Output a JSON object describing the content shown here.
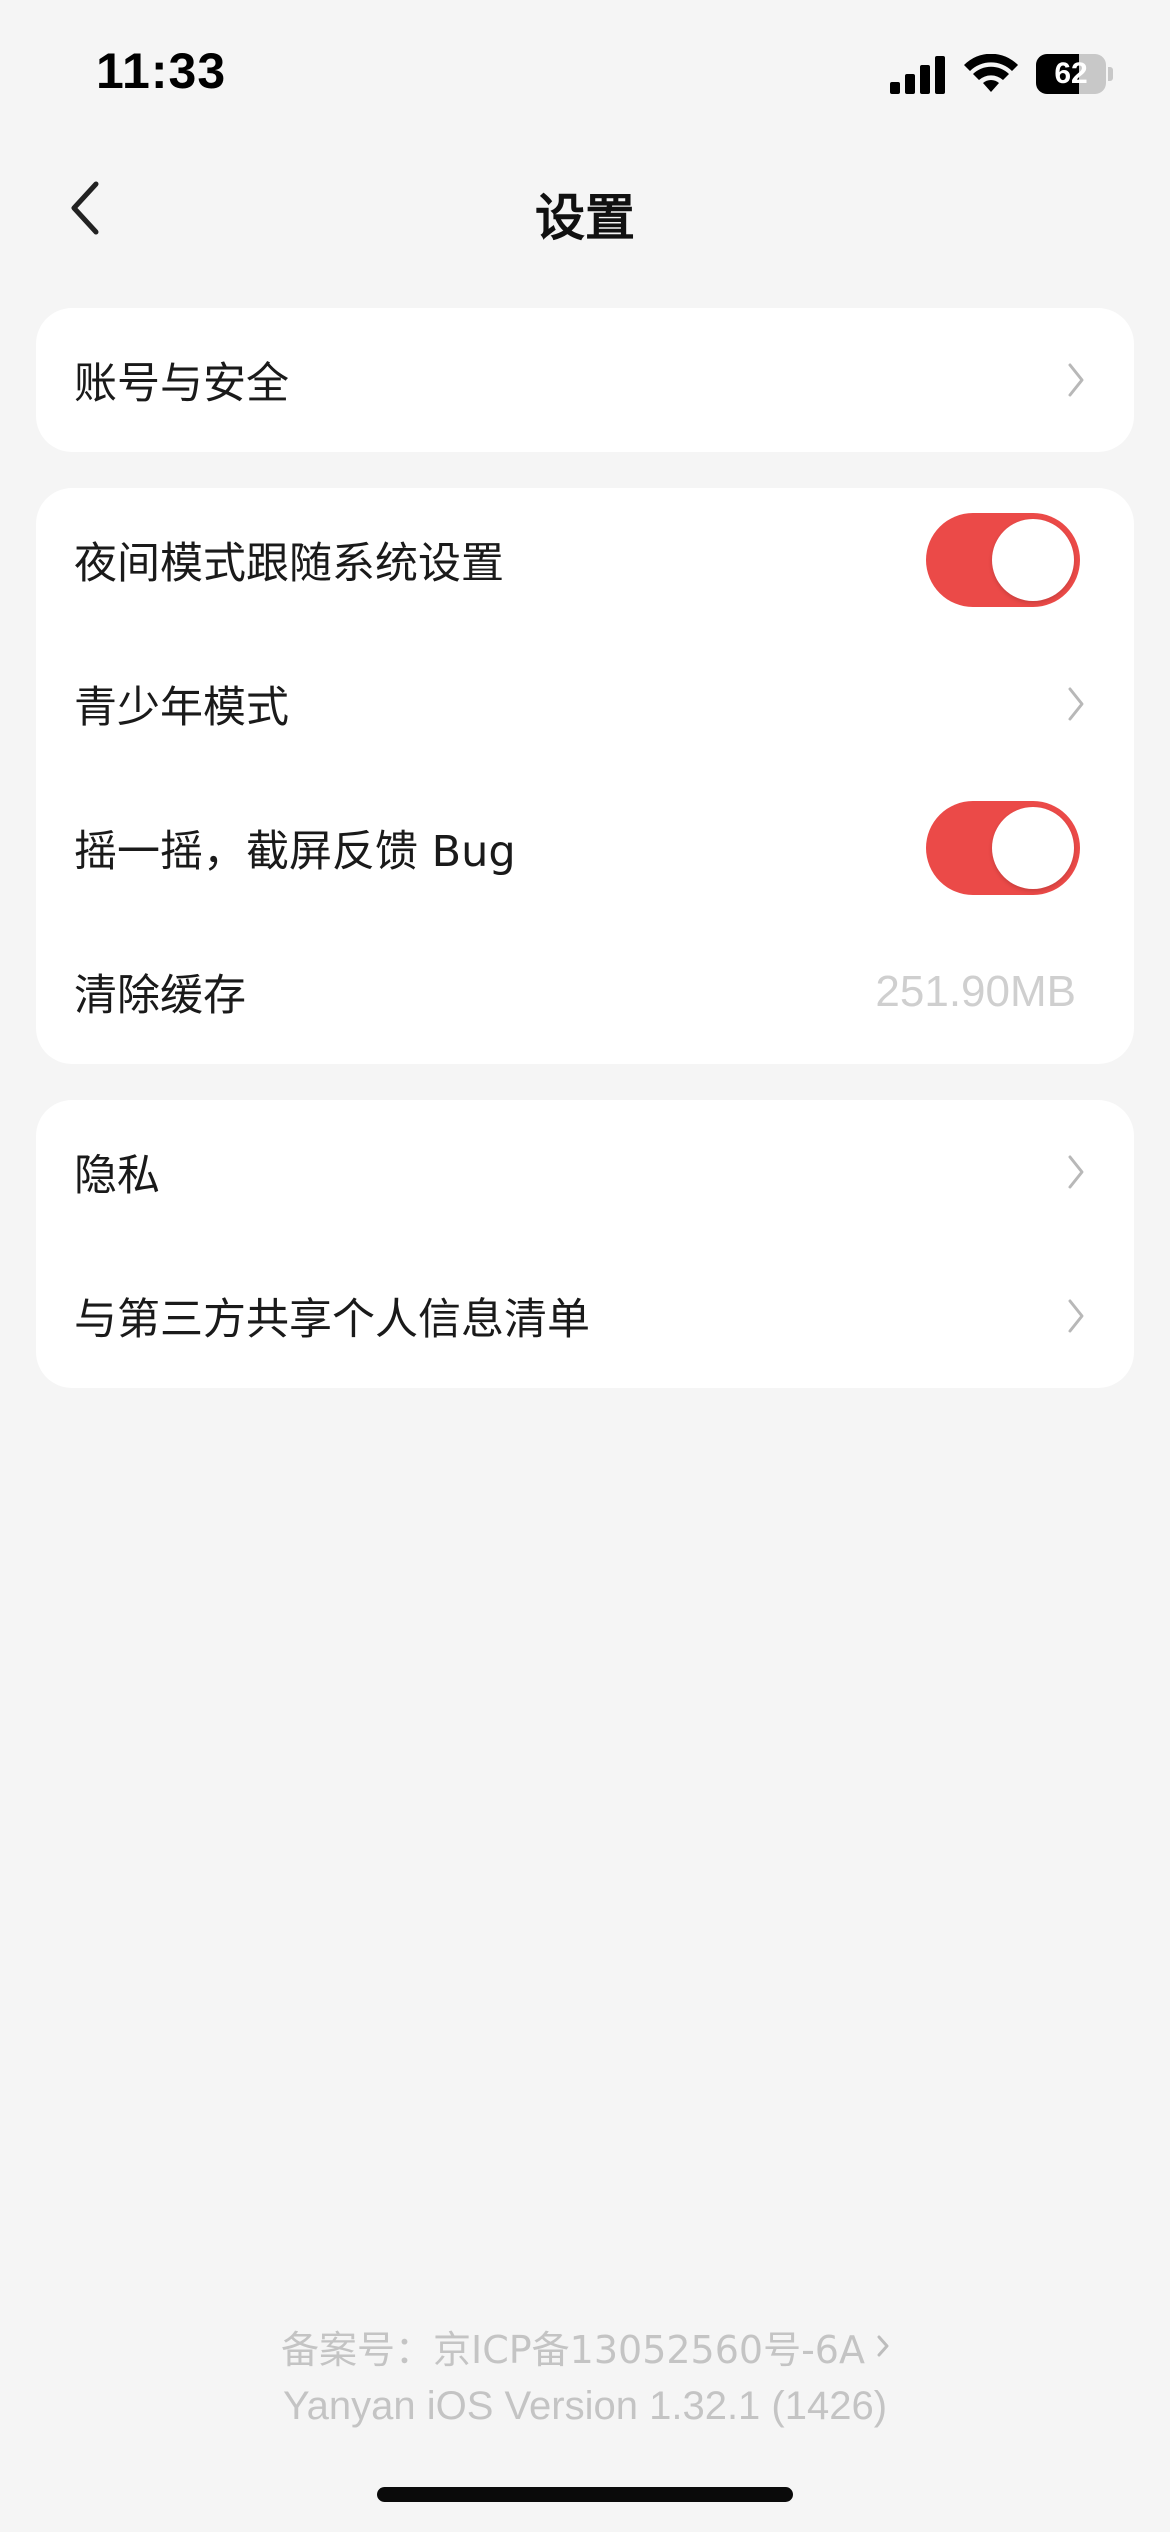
{
  "status_bar": {
    "time": "11:33",
    "battery_level": "62",
    "icons": [
      "signal-icon",
      "wifi-icon",
      "battery-icon"
    ]
  },
  "nav": {
    "title": "设置",
    "back_icon": "chevron-left-icon"
  },
  "sections": [
    {
      "rows": [
        {
          "label": "账号与安全",
          "accessory": "chevron-right-icon"
        }
      ]
    },
    {
      "rows": [
        {
          "label": "夜间模式跟随系统设置",
          "accessory": "toggle",
          "toggle_on": true
        },
        {
          "label": "青少年模式",
          "accessory": "chevron-right-icon"
        },
        {
          "label": "摇一摇，截屏反馈 Bug",
          "accessory": "toggle",
          "toggle_on": true
        },
        {
          "label": "清除缓存",
          "value": "251.90MB"
        }
      ]
    },
    {
      "rows": [
        {
          "label": "隐私",
          "accessory": "chevron-right-icon"
        },
        {
          "label": "与第三方共享个人信息清单",
          "accessory": "chevron-right-icon"
        }
      ]
    }
  ],
  "footer": {
    "icp": "备案号：京ICP备13052560号-6A",
    "version": "Yanyan iOS Version 1.32.1 (1426)"
  },
  "colors": {
    "accent": "#eb4a48",
    "background": "#f5f5f5",
    "card": "#ffffff",
    "muted_text": "#c4c4c4"
  }
}
